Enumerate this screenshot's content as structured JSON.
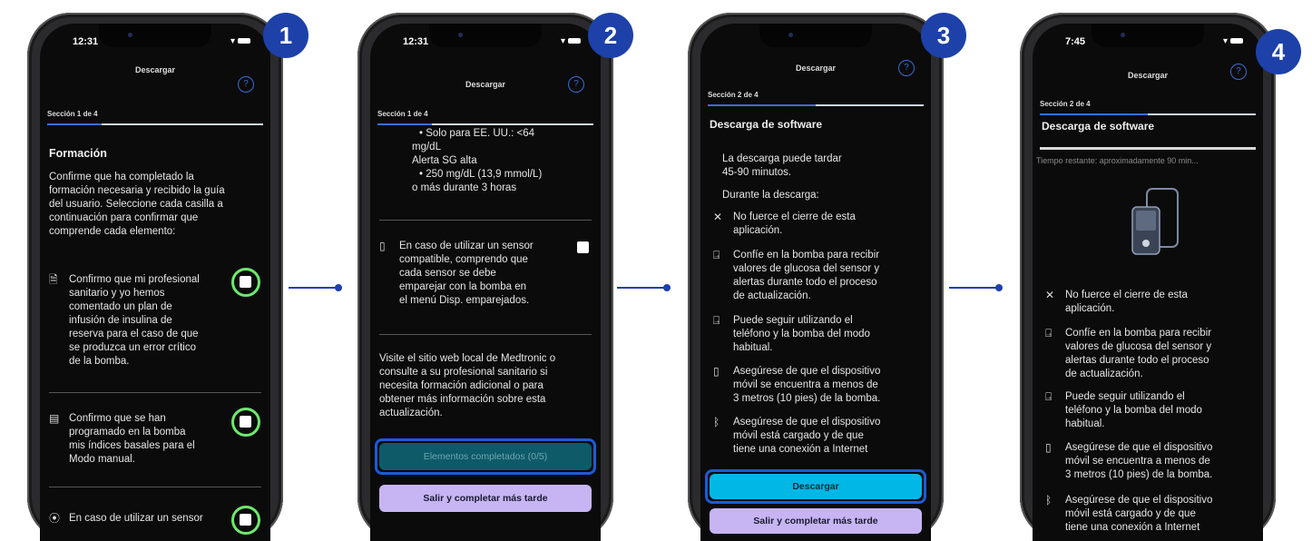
{
  "steps": [
    {
      "badge": "1",
      "time": "12:31",
      "app_title": "Descargar",
      "section": "Sección 1 de 4",
      "heading": "Formación",
      "intro": [
        "Confirme que ha completado la",
        "formación necesaria y recibido la guía",
        "del usuario. Seleccione cada casilla a",
        "continuación para confirmar que",
        "comprende cada elemento:"
      ],
      "items": [
        {
          "icon": "document-icon",
          "lines": [
            "Confirmo que mi profesional",
            "sanitario y yo hemos",
            "comentado un plan de",
            "infusión de insulina de",
            "reserva para el caso de que",
            "se produzca un error crítico",
            "de la bomba."
          ]
        },
        {
          "icon": "form-icon",
          "lines": [
            "Confirmo que se han",
            "programado en la bomba",
            "mis índices basales para el",
            "Modo manual."
          ]
        },
        {
          "icon": "sensor-icon",
          "lines": [
            "En caso de utilizar un sensor"
          ]
        }
      ]
    },
    {
      "badge": "2",
      "time": "12:31",
      "app_title": "Descargar",
      "section": "Sección 1 de 4",
      "top_lines": [
        "• Solo para EE. UU.: <64",
        "mg/dL",
        "Alerta SG alta",
        "• 250 mg/dL (13,9 mmol/L)",
        "o más durante 3 horas"
      ],
      "item_lines": [
        "En caso de utilizar un sensor",
        "compatible, comprendo que",
        "cada sensor se debe",
        "emparejar con la bomba en",
        "el menú Disp. emparejados."
      ],
      "info_lines": [
        "Visite el sitio web local de Medtronic o",
        "consulte a su profesional sanitario si",
        "necesita formación adicional o para",
        "obtener más información sobre esta",
        "actualización."
      ],
      "btn_completed": "Elementos completados (0/5)",
      "btn_exit": "Salir y completar más tarde"
    },
    {
      "badge": "3",
      "app_title": "Descargar",
      "section": "Sección 2 de 4",
      "heading": "Descarga de software",
      "duration_lines": [
        "La descarga puede tardar",
        "45-90 minutos."
      ],
      "during": "Durante la descarga:",
      "items": [
        {
          "icon": "close-icon",
          "lines": [
            "No fuerce el cierre de esta",
            "aplicación."
          ]
        },
        {
          "icon": "pump-icon",
          "lines": [
            "Confíe en la bomba para recibir",
            "valores de glucosa del sensor y",
            "alertas durante todo el proceso",
            "de actualización."
          ]
        },
        {
          "icon": "pump-icon",
          "lines": [
            "Puede seguir utilizando el",
            "teléfono y la bomba del modo",
            "habitual."
          ]
        },
        {
          "icon": "phone-range-icon",
          "lines": [
            "Asegúrese de que el dispositivo",
            "móvil se encuentra a menos de",
            "3 metros (10 pies) de la bomba."
          ]
        },
        {
          "icon": "bluetooth-icon",
          "lines": [
            "Asegúrese de que el dispositivo",
            "móvil está cargado y de que",
            "tiene una conexión a Internet"
          ]
        }
      ],
      "btn_download": "Descargar",
      "btn_exit": "Salir y completar más tarde"
    },
    {
      "badge": "4",
      "time": "7:45",
      "app_title": "Descargar",
      "section": "Sección 2 de 4",
      "heading": "Descarga de software",
      "remaining": "Tiempo restante: aproximadamente 90 min...",
      "items": [
        {
          "icon": "close-icon",
          "lines": [
            "No fuerce el cierre de esta",
            "aplicación."
          ]
        },
        {
          "icon": "pump-icon",
          "lines": [
            "Confíe en la bomba para recibir",
            "valores de glucosa del sensor y",
            "alertas durante todo el proceso",
            "de actualización."
          ]
        },
        {
          "icon": "pump-icon",
          "lines": [
            "Puede seguir utilizando el",
            "teléfono y la bomba del modo",
            "habitual."
          ]
        },
        {
          "icon": "phone-range-icon",
          "lines": [
            "Asegúrese de que el dispositivo",
            "móvil se encuentra a menos de",
            "3 metros (10 pies) de la bomba."
          ]
        },
        {
          "icon": "bluetooth-icon",
          "lines": [
            "Asegúrese de que el dispositivo",
            "móvil está cargado y de que",
            "tiene una conexión a Internet"
          ]
        }
      ]
    }
  ],
  "help_symbol": "?",
  "colors": {
    "badge": "#1d41a8",
    "accent_ring": "#6ee86e",
    "btn_cyan": "#00b7e6",
    "btn_lavender": "#c7b4f3",
    "btn_teal": "#0e5a68"
  }
}
